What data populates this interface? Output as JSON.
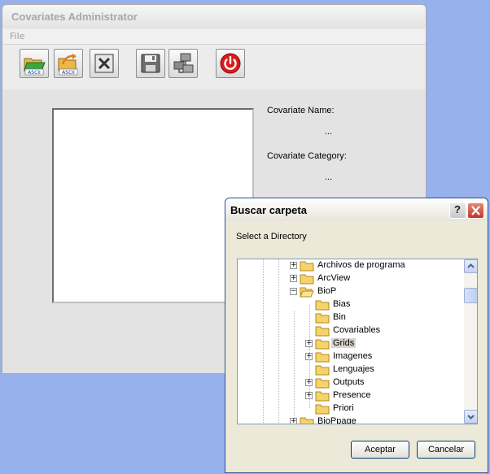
{
  "main_window": {
    "title": "Covariates Administrator",
    "menu": {
      "file_label": "File"
    },
    "toolbar": {
      "buttons": [
        {
          "name": "import-ascii-1",
          "icon": "folder-open-ascii-icon",
          "label": "ASCII"
        },
        {
          "name": "import-ascii-2",
          "icon": "folder-import-ascii-icon",
          "label": "ASCII"
        },
        {
          "name": "delete",
          "icon": "delete-x-icon"
        },
        {
          "name": "save",
          "icon": "floppy-disk-icon"
        },
        {
          "name": "network",
          "icon": "network-computers-icon"
        },
        {
          "name": "power",
          "icon": "power-icon",
          "color": "#d81c1c"
        }
      ]
    },
    "fields": {
      "name_label": "Covariate Name:",
      "name_value": "...",
      "category_label": "Covariate Category:",
      "category_value": "..."
    }
  },
  "dialog": {
    "title": "Buscar carpeta",
    "help_label": "?",
    "prompt": "Select a Directory",
    "tree": [
      {
        "label": "Archivos de programa",
        "expander": "+"
      },
      {
        "label": "ArcView",
        "expander": "+"
      },
      {
        "label": "BioP",
        "expander": "−"
      },
      {
        "label": "Bias",
        "expander": ""
      },
      {
        "label": "Bin",
        "expander": ""
      },
      {
        "label": "Covariables",
        "expander": ""
      },
      {
        "label": "Grids",
        "expander": "+",
        "selected": true
      },
      {
        "label": "Imagenes",
        "expander": "+"
      },
      {
        "label": "Lenguajes",
        "expander": ""
      },
      {
        "label": "Outputs",
        "expander": "+"
      },
      {
        "label": "Presence",
        "expander": "+"
      },
      {
        "label": "Priori",
        "expander": ""
      },
      {
        "label": "BioPpage",
        "expander": "+"
      }
    ],
    "ok_label": "Aceptar",
    "cancel_label": "Cancelar"
  },
  "colors": {
    "desktop": "#97b1ec",
    "dialog_bg": "#ece9d8",
    "close_red": "#c1362a",
    "folder_yellow": "#f5d36a"
  }
}
